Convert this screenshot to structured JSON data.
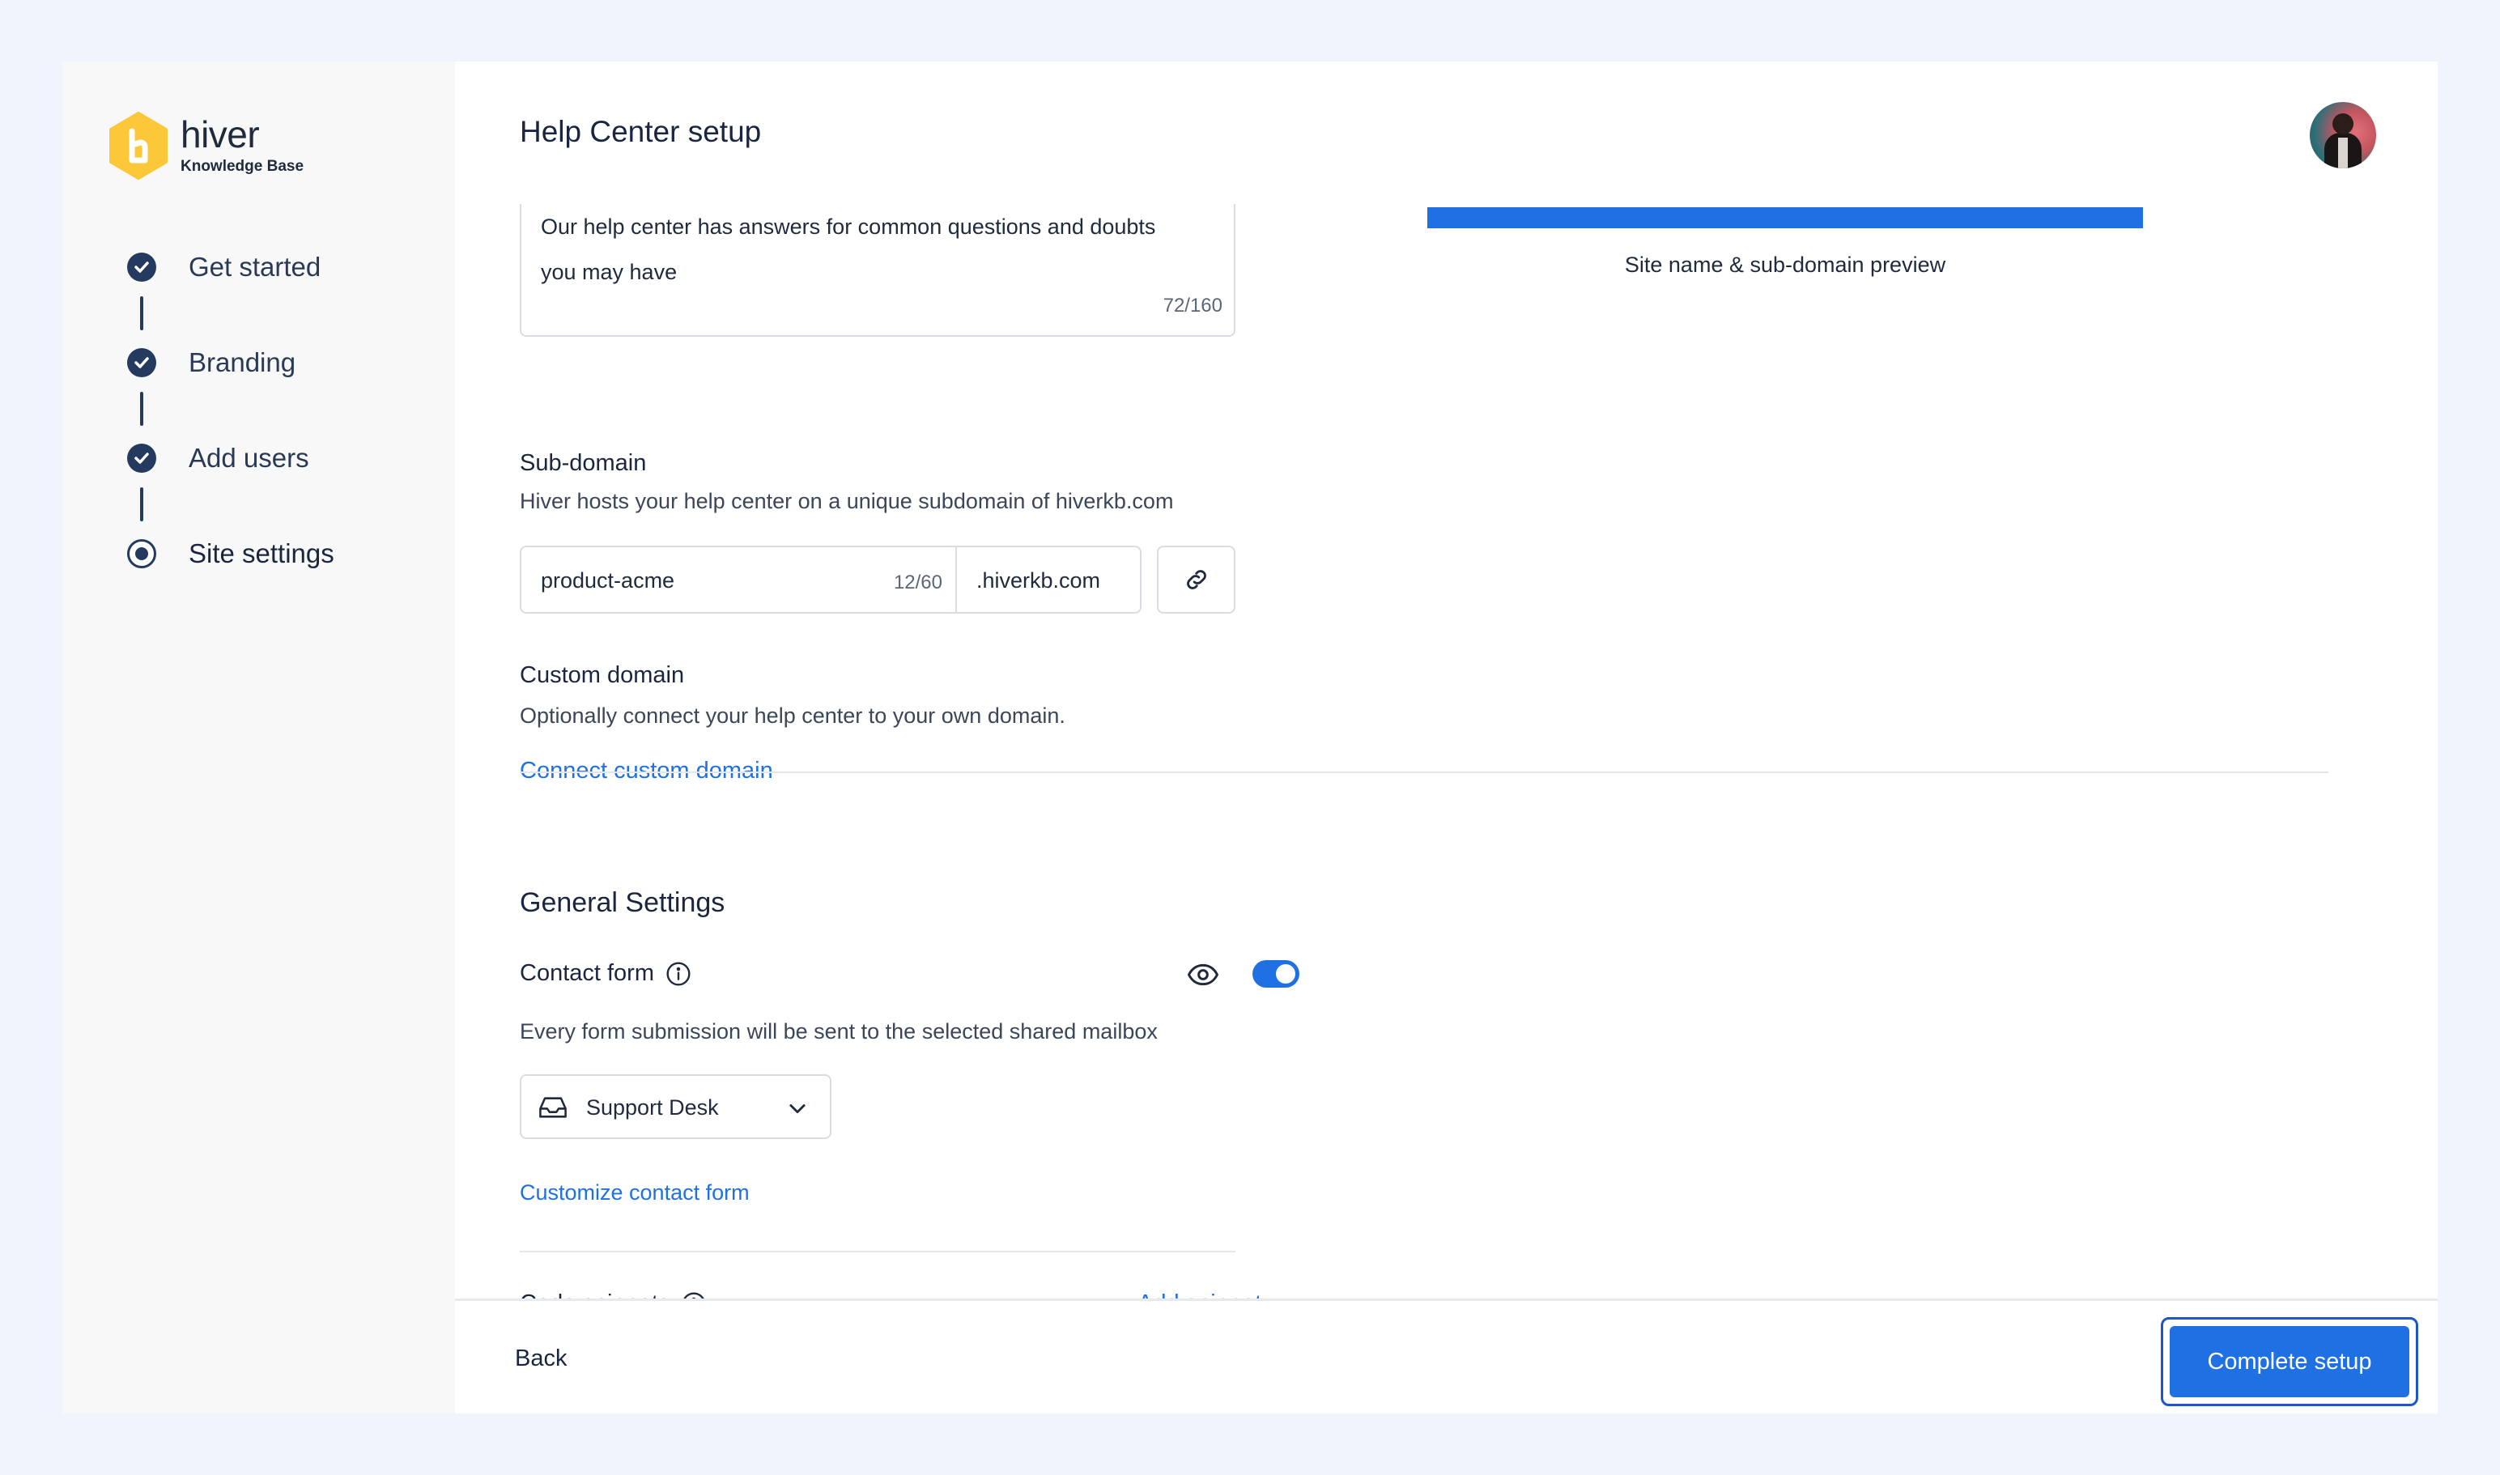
{
  "brand": {
    "name": "hiver",
    "subtitle": "Knowledge Base",
    "accent": "#fdc73a"
  },
  "steps": [
    {
      "label": "Get started",
      "status": "done"
    },
    {
      "label": "Branding",
      "status": "done"
    },
    {
      "label": "Add users",
      "status": "done"
    },
    {
      "label": "Site settings",
      "status": "current"
    }
  ],
  "header": {
    "title": "Help Center setup"
  },
  "description_field": {
    "value": "Our help center has answers for common questions and doubts you may have",
    "count": "72/160"
  },
  "preview": {
    "caption": "Site name & sub-domain preview",
    "bar_color": "#1f71e3"
  },
  "subdomain": {
    "label": "Sub-domain",
    "description": "Hiver hosts your help center on a unique subdomain of hiverkb.com",
    "value": "product-acme",
    "count": "12/60",
    "suffix": ".hiverkb.com",
    "link_icon": "link-icon"
  },
  "custom_domain": {
    "label": "Custom domain",
    "description": "Optionally connect your help center to your own domain.",
    "link": "Connect custom domain"
  },
  "general": {
    "title": "General Settings",
    "contact_form": {
      "label": "Contact form",
      "enabled": true,
      "description": "Every form submission will be sent to the selected shared mailbox",
      "mailbox": "Support Desk",
      "customize_link": "Customize contact form"
    },
    "code_snippets": {
      "label": "Code snippets",
      "add_link": "Add snippet"
    }
  },
  "footer": {
    "back_label": "Back",
    "complete_label": "Complete setup"
  },
  "colors": {
    "primary": "#1f71e3",
    "step": "#243a5e"
  }
}
